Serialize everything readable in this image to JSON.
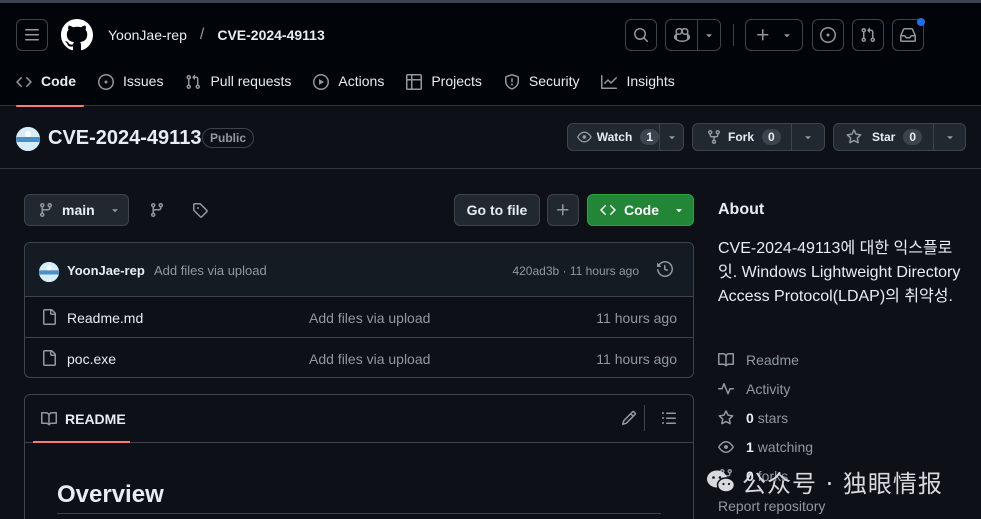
{
  "header": {
    "owner": "YoonJae-rep",
    "separator": "/",
    "repo": "CVE-2024-49113"
  },
  "tabs": [
    {
      "label": "Code",
      "icon": "code-icon"
    },
    {
      "label": "Issues",
      "icon": "issue-icon"
    },
    {
      "label": "Pull requests",
      "icon": "pull-request-icon"
    },
    {
      "label": "Actions",
      "icon": "play-icon"
    },
    {
      "label": "Projects",
      "icon": "table-icon"
    },
    {
      "label": "Security",
      "icon": "shield-icon"
    },
    {
      "label": "Insights",
      "icon": "graph-icon"
    }
  ],
  "repo_header": {
    "title": "CVE-2024-49113",
    "visibility": "Public",
    "watch_label": "Watch",
    "watch_count": "1",
    "fork_label": "Fork",
    "fork_count": "0",
    "star_label": "Star",
    "star_count": "0"
  },
  "toolbar": {
    "branch": "main",
    "go_to_file": "Go to file",
    "code_label": "Code"
  },
  "commit": {
    "author": "YoonJae-rep",
    "message": "Add files via upload",
    "meta": "420ad3b · 11 hours ago"
  },
  "files": [
    {
      "name": "Readme.md",
      "message": "Add files via upload",
      "time": "11 hours ago"
    },
    {
      "name": "poc.exe",
      "message": "Add files via upload",
      "time": "11 hours ago"
    }
  ],
  "readme": {
    "tab_label": "README",
    "heading": "Overview"
  },
  "about": {
    "title": "About",
    "description": "CVE-2024-49113에 대한 익스플로잇. Windows Lightweight Directory Access Protocol(LDAP)의 취약성.",
    "readme": "Readme",
    "activity": "Activity",
    "stars_count": "0",
    "stars_label": "stars",
    "watching_count": "1",
    "watching_label": "watching",
    "forks_count": "0",
    "forks_label": "forks",
    "report": "Report repository"
  },
  "watermark": {
    "text": "公众号 · 独眼情报"
  },
  "colors": {
    "background": "#0d1117",
    "header_bg": "#010409",
    "accent_underline": "#f78166",
    "code_button": "#238636",
    "notification_dot": "#1f6feb"
  }
}
